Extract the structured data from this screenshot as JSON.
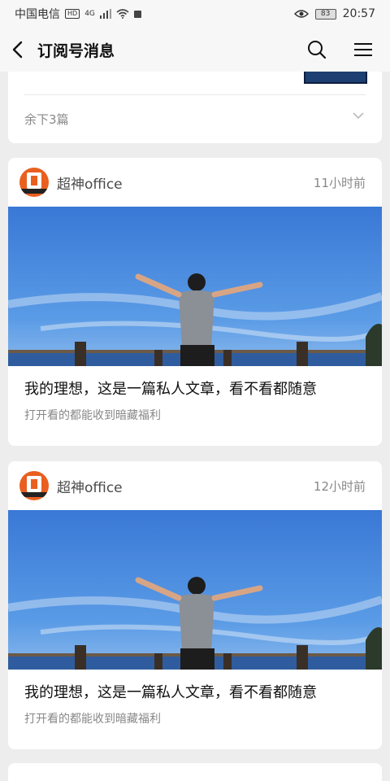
{
  "status_bar": {
    "carrier": "中国电信",
    "hd_badge": "HD",
    "network": "4G",
    "battery": "83",
    "time": "20:57"
  },
  "nav": {
    "title": "订阅号消息"
  },
  "top_card": {
    "remaining_text": "余下3篇"
  },
  "articles": [
    {
      "author": "超神office",
      "time": "11小时前",
      "title": "我的理想，这是一篇私人文章，看不看都随意",
      "digest": "打开看的都能收到暗藏福利"
    },
    {
      "author": "超神office",
      "time": "12小时前",
      "title": "我的理想，这是一篇私人文章，看不看都随意",
      "digest": "打开看的都能收到暗藏福利"
    }
  ],
  "colors": {
    "background": "#ededed",
    "card": "#ffffff",
    "logo_orange": "#e95f1f",
    "sky_blue": "#3f86de"
  }
}
